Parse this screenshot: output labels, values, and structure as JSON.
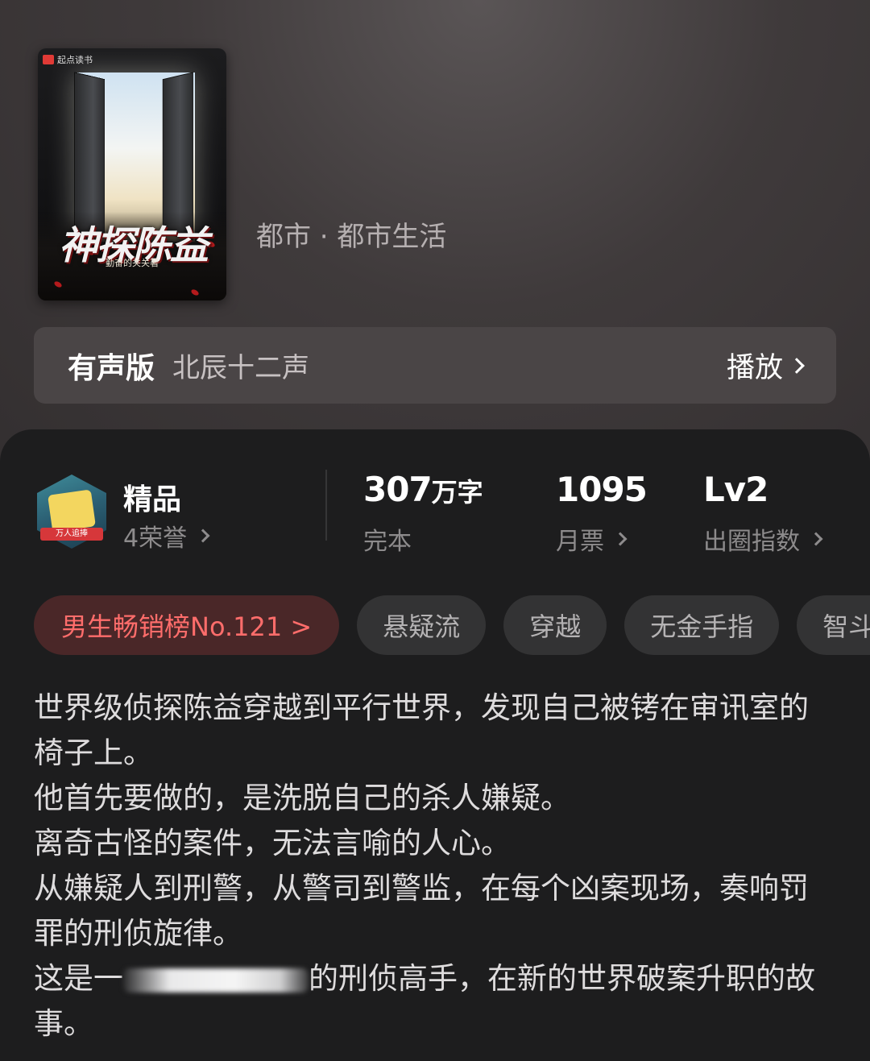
{
  "book": {
    "cover": {
      "brand": "起点读书",
      "title": "神探陈益",
      "author": "勤奋的关关著"
    },
    "genre": "都市 · 都市生活"
  },
  "audio": {
    "label": "有声版",
    "narrator": "北辰十二声",
    "play_label": "播放"
  },
  "stats": {
    "quality": {
      "title": "精品",
      "honors": "4荣誉",
      "badge_text": "万人追捧"
    },
    "words": {
      "value": "307",
      "unit": "万字",
      "status": "完本"
    },
    "monthly": {
      "value": "1095",
      "label": "月票"
    },
    "influence": {
      "value": "Lv2",
      "label": "出圈指数"
    }
  },
  "tags": {
    "rank": "男生畅销榜No.121 >",
    "items": [
      "悬疑流",
      "穿越",
      "无金手指",
      "智斗"
    ]
  },
  "synopsis": {
    "lines": [
      "世界级侦探陈益穿越到平行世界，发现自己被铐在审讯室的椅子上。",
      "他首先要做的，是洗脱自己的杀人嫌疑。",
      "离奇古怪的案件，无法言喻的人心。",
      "从嫌疑人到刑警，从警司到警监，在每个凶案现场，奏响罚罪的刑侦旋律。"
    ],
    "last_prefix": "这是一",
    "last_suffix": "的刑侦高手，在新的世界破案升职的故事。"
  },
  "colors": {
    "rank_text": "#ff6d6b",
    "rank_bg": "#4a2728",
    "sheet_bg": "#1d1d1e"
  }
}
